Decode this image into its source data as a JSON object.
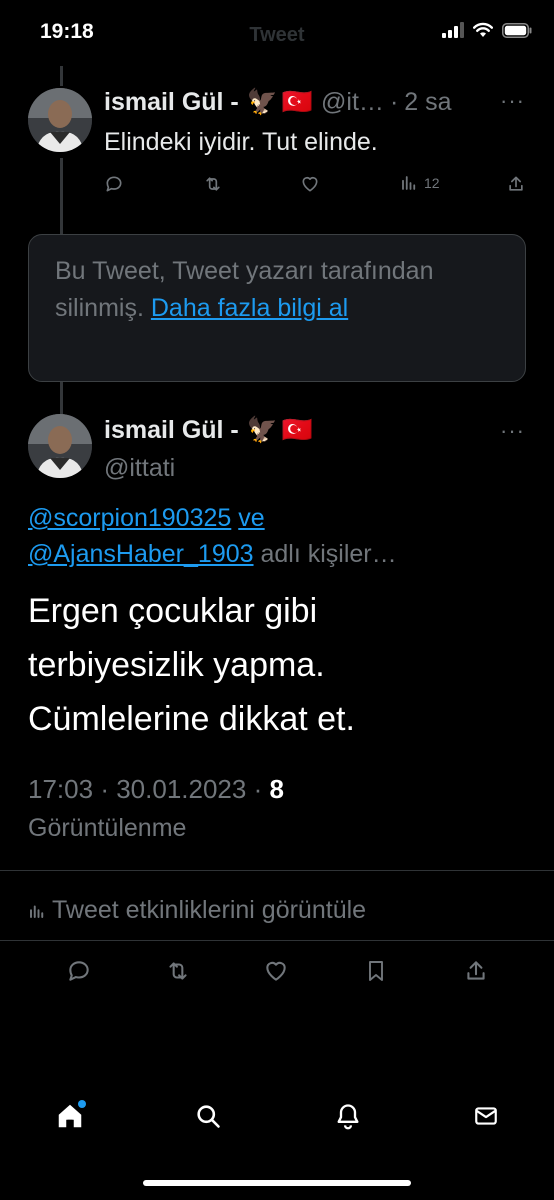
{
  "status_bar": {
    "time": "19:18",
    "title": "Tweet"
  },
  "tweet_parent": {
    "display_name": "ismail Gül -",
    "handle": "@it…",
    "separator": "·",
    "time": "2 sa",
    "more": "···",
    "text": "Elindeki iyidir. Tut elinde.",
    "views": "12"
  },
  "deleted_notice": {
    "text": "Bu Tweet, Tweet yazarı tarafından silinmiş.",
    "link": "Daha fazla bilgi al"
  },
  "main_tweet": {
    "display_name": "ismail Gül -",
    "handle": "@ittati",
    "more": "···",
    "reply_mention_1": "@scorpion190325",
    "reply_connector": "ve",
    "reply_mention_2": "@AjansHaber_1903",
    "reply_suffix": "adlı kişiler…",
    "text_line_1": "Ergen çocuklar gibi",
    "text_line_2": "terbiyesizlik yapma.",
    "text_line_3": "Cümlelerine dikkat et.",
    "time": "17:03",
    "dot": "·",
    "date": "30.01.2023",
    "views_count": "8",
    "views_label": "Görüntülenme",
    "analytics_label": "Tweet etkinliklerini görüntüle"
  },
  "icons": {
    "emoji_eagle": "🦅",
    "emoji_flag": "🇹🇷"
  },
  "colors": {
    "accent": "#1d9bf0",
    "muted": "#71767b",
    "background": "#000000"
  }
}
